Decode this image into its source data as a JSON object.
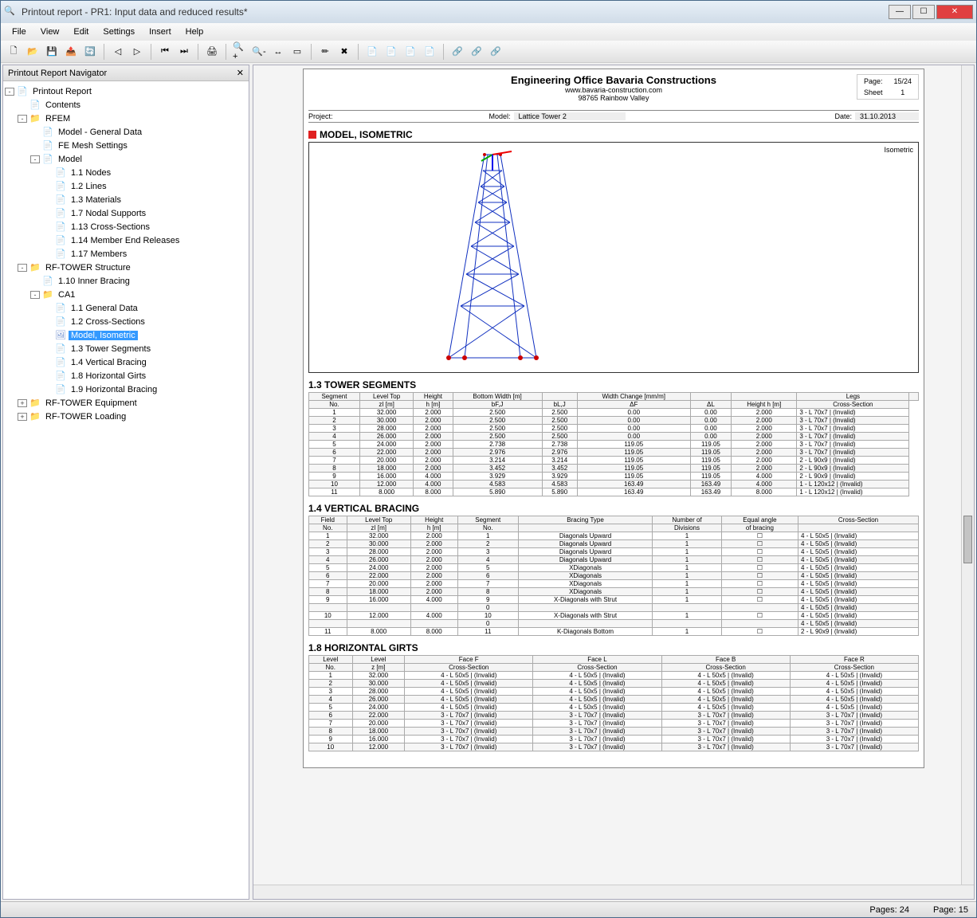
{
  "window": {
    "title": "Printout report - PR1: Input data and reduced results*"
  },
  "menu": [
    "File",
    "View",
    "Edit",
    "Settings",
    "Insert",
    "Help"
  ],
  "navigator": {
    "title": "Printout Report Navigator",
    "tree": [
      {
        "d": 0,
        "exp": "-",
        "ico": "doc",
        "label": "Printout Report"
      },
      {
        "d": 1,
        "exp": "",
        "ico": "doc",
        "label": "Contents"
      },
      {
        "d": 1,
        "exp": "-",
        "ico": "folder",
        "label": "RFEM"
      },
      {
        "d": 2,
        "exp": "",
        "ico": "doc",
        "label": "Model - General Data"
      },
      {
        "d": 2,
        "exp": "",
        "ico": "doc",
        "label": "FE Mesh Settings"
      },
      {
        "d": 2,
        "exp": "-",
        "ico": "doc",
        "label": "Model"
      },
      {
        "d": 3,
        "exp": "",
        "ico": "doc",
        "label": "1.1 Nodes"
      },
      {
        "d": 3,
        "exp": "",
        "ico": "doc",
        "label": "1.2 Lines"
      },
      {
        "d": 3,
        "exp": "",
        "ico": "doc",
        "label": "1.3 Materials"
      },
      {
        "d": 3,
        "exp": "",
        "ico": "doc",
        "label": "1.7 Nodal Supports"
      },
      {
        "d": 3,
        "exp": "",
        "ico": "doc",
        "label": "1.13 Cross-Sections"
      },
      {
        "d": 3,
        "exp": "",
        "ico": "doc",
        "label": "1.14 Member End Releases"
      },
      {
        "d": 3,
        "exp": "",
        "ico": "doc",
        "label": "1.17 Members"
      },
      {
        "d": 1,
        "exp": "-",
        "ico": "folder",
        "label": "RF-TOWER Structure"
      },
      {
        "d": 2,
        "exp": "",
        "ico": "doc",
        "label": "1.10 Inner Bracing"
      },
      {
        "d": 2,
        "exp": "-",
        "ico": "folder",
        "label": "CA1"
      },
      {
        "d": 3,
        "exp": "",
        "ico": "doc",
        "label": "1.1 General Data"
      },
      {
        "d": 3,
        "exp": "",
        "ico": "doc",
        "label": "1.2 Cross-Sections"
      },
      {
        "d": 3,
        "exp": "",
        "ico": "img",
        "label": "Model, Isometric",
        "sel": true
      },
      {
        "d": 3,
        "exp": "",
        "ico": "doc",
        "label": "1.3 Tower Segments"
      },
      {
        "d": 3,
        "exp": "",
        "ico": "doc",
        "label": "1.4 Vertical Bracing"
      },
      {
        "d": 3,
        "exp": "",
        "ico": "doc",
        "label": "1.8 Horizontal Girts"
      },
      {
        "d": 3,
        "exp": "",
        "ico": "doc",
        "label": "1.9 Horizontal Bracing"
      },
      {
        "d": 1,
        "exp": "+",
        "ico": "folder",
        "label": "RF-TOWER Equipment"
      },
      {
        "d": 1,
        "exp": "+",
        "ico": "folder",
        "label": "RF-TOWER Loading"
      }
    ]
  },
  "report": {
    "office": "Engineering Office Bavaria Constructions",
    "website": "www.bavaria-construction.com",
    "address": "98765 Rainbow Valley",
    "page_label": "Page:",
    "page_val": "15/24",
    "sheet_label": "Sheet",
    "sheet_val": "1",
    "project_label": "Project:",
    "project_val": "",
    "model_label": "Model:",
    "model_val": "Lattice Tower 2",
    "date_label": "Date:",
    "date_val": "31.10.2013",
    "sec_iso": "MODEL, ISOMETRIC",
    "iso_label": "Isometric",
    "sec_seg": "1.3 TOWER SEGMENTS",
    "seg_head1": [
      "Segment",
      "Level Top",
      "Height",
      "Bottom Width [m]",
      "",
      "Width Change [mm/m]",
      "",
      "",
      "Legs",
      ""
    ],
    "seg_head2": [
      "No.",
      "zI [m]",
      "h [m]",
      "bF,J",
      "bL,J",
      "ΔF",
      "ΔL",
      "Height h [m]",
      "Cross-Section"
    ],
    "seg_rows": [
      [
        "1",
        "32.000",
        "2.000",
        "2.500",
        "2.500",
        "0.00",
        "0.00",
        "2.000",
        "3 - L 70x7 | (Invalid)"
      ],
      [
        "2",
        "30.000",
        "2.000",
        "2.500",
        "2.500",
        "0.00",
        "0.00",
        "2.000",
        "3 - L 70x7 | (Invalid)"
      ],
      [
        "3",
        "28.000",
        "2.000",
        "2.500",
        "2.500",
        "0.00",
        "0.00",
        "2.000",
        "3 - L 70x7 | (Invalid)"
      ],
      [
        "4",
        "26.000",
        "2.000",
        "2.500",
        "2.500",
        "0.00",
        "0.00",
        "2.000",
        "3 - L 70x7 | (Invalid)"
      ],
      [
        "5",
        "24.000",
        "2.000",
        "2.738",
        "2.738",
        "119.05",
        "119.05",
        "2.000",
        "3 - L 70x7 | (Invalid)"
      ],
      [
        "6",
        "22.000",
        "2.000",
        "2.976",
        "2.976",
        "119.05",
        "119.05",
        "2.000",
        "3 - L 70x7 | (Invalid)"
      ],
      [
        "7",
        "20.000",
        "2.000",
        "3.214",
        "3.214",
        "119.05",
        "119.05",
        "2.000",
        "2 - L 90x9 | (Invalid)"
      ],
      [
        "8",
        "18.000",
        "2.000",
        "3.452",
        "3.452",
        "119.05",
        "119.05",
        "2.000",
        "2 - L 90x9 | (Invalid)"
      ],
      [
        "9",
        "16.000",
        "4.000",
        "3.929",
        "3.929",
        "119.05",
        "119.05",
        "4.000",
        "2 - L 90x9 | (Invalid)"
      ],
      [
        "10",
        "12.000",
        "4.000",
        "4.583",
        "4.583",
        "163.49",
        "163.49",
        "4.000",
        "1 - L 120x12 | (Invalid)"
      ],
      [
        "11",
        "8.000",
        "8.000",
        "5.890",
        "5.890",
        "163.49",
        "163.49",
        "8.000",
        "1 - L 120x12 | (Invalid)"
      ]
    ],
    "sec_vb": "1.4 VERTICAL BRACING",
    "vb_head1": [
      "Field",
      "Level Top",
      "Height",
      "Segment",
      "Bracing Type",
      "Number of",
      "Equal angle",
      "Cross-Section"
    ],
    "vb_head2": [
      "No.",
      "zI [m]",
      "h [m]",
      "No.",
      "",
      "Divisions",
      "of bracing",
      ""
    ],
    "vb_rows": [
      [
        "1",
        "32.000",
        "2.000",
        "1",
        "Diagonals Upward",
        "1",
        "☐",
        "4 - L 50x5 | (Invalid)"
      ],
      [
        "2",
        "30.000",
        "2.000",
        "2",
        "Diagonals Upward",
        "1",
        "☐",
        "4 - L 50x5 | (Invalid)"
      ],
      [
        "3",
        "28.000",
        "2.000",
        "3",
        "Diagonals Upward",
        "1",
        "☐",
        "4 - L 50x5 | (Invalid)"
      ],
      [
        "4",
        "26.000",
        "2.000",
        "4",
        "Diagonals Upward",
        "1",
        "☐",
        "4 - L 50x5 | (Invalid)"
      ],
      [
        "5",
        "24.000",
        "2.000",
        "5",
        "XDiagonals",
        "1",
        "☐",
        "4 - L 50x5 | (Invalid)"
      ],
      [
        "6",
        "22.000",
        "2.000",
        "6",
        "XDiagonals",
        "1",
        "☐",
        "4 - L 50x5 | (Invalid)"
      ],
      [
        "7",
        "20.000",
        "2.000",
        "7",
        "XDiagonals",
        "1",
        "☐",
        "4 - L 50x5 | (Invalid)"
      ],
      [
        "8",
        "18.000",
        "2.000",
        "8",
        "XDiagonals",
        "1",
        "☐",
        "4 - L 50x5 | (Invalid)"
      ],
      [
        "9",
        "16.000",
        "4.000",
        "9",
        "X-Diagonals with Strut",
        "1",
        "☐",
        "4 - L 50x5 | (Invalid)"
      ],
      [
        "",
        "",
        "",
        "0",
        "",
        "",
        "",
        "4 - L 50x5 | (Invalid)"
      ],
      [
        "10",
        "12.000",
        "4.000",
        "10",
        "X-Diagonals with Strut",
        "1",
        "☐",
        "4 - L 50x5 | (Invalid)"
      ],
      [
        "",
        "",
        "",
        "0",
        "",
        "",
        "",
        "4 - L 50x5 | (Invalid)"
      ],
      [
        "11",
        "8.000",
        "8.000",
        "11",
        "K-Diagonals Bottom",
        "1",
        "☐",
        "2 - L 90x9 | (Invalid)"
      ]
    ],
    "sec_hg": "1.8 HORIZONTAL GIRTS",
    "hg_head1": [
      "Level",
      "Level",
      "Face F",
      "Face L",
      "Face B",
      "Face R"
    ],
    "hg_head2": [
      "No.",
      "z [m]",
      "Cross-Section",
      "Cross-Section",
      "Cross-Section",
      "Cross-Section"
    ],
    "hg_rows": [
      [
        "1",
        "32.000",
        "4 - L 50x5 | (Invalid)",
        "4 - L 50x5 | (Invalid)",
        "4 - L 50x5 | (Invalid)",
        "4 - L 50x5 | (Invalid)"
      ],
      [
        "2",
        "30.000",
        "4 - L 50x5 | (Invalid)",
        "4 - L 50x5 | (Invalid)",
        "4 - L 50x5 | (Invalid)",
        "4 - L 50x5 | (Invalid)"
      ],
      [
        "3",
        "28.000",
        "4 - L 50x5 | (Invalid)",
        "4 - L 50x5 | (Invalid)",
        "4 - L 50x5 | (Invalid)",
        "4 - L 50x5 | (Invalid)"
      ],
      [
        "4",
        "26.000",
        "4 - L 50x5 | (Invalid)",
        "4 - L 50x5 | (Invalid)",
        "4 - L 50x5 | (Invalid)",
        "4 - L 50x5 | (Invalid)"
      ],
      [
        "5",
        "24.000",
        "4 - L 50x5 | (Invalid)",
        "4 - L 50x5 | (Invalid)",
        "4 - L 50x5 | (Invalid)",
        "4 - L 50x5 | (Invalid)"
      ],
      [
        "6",
        "22.000",
        "3 - L 70x7 | (Invalid)",
        "3 - L 70x7 | (Invalid)",
        "3 - L 70x7 | (Invalid)",
        "3 - L 70x7 | (Invalid)"
      ],
      [
        "7",
        "20.000",
        "3 - L 70x7 | (Invalid)",
        "3 - L 70x7 | (Invalid)",
        "3 - L 70x7 | (Invalid)",
        "3 - L 70x7 | (Invalid)"
      ],
      [
        "8",
        "18.000",
        "3 - L 70x7 | (Invalid)",
        "3 - L 70x7 | (Invalid)",
        "3 - L 70x7 | (Invalid)",
        "3 - L 70x7 | (Invalid)"
      ],
      [
        "9",
        "16.000",
        "3 - L 70x7 | (Invalid)",
        "3 - L 70x7 | (Invalid)",
        "3 - L 70x7 | (Invalid)",
        "3 - L 70x7 | (Invalid)"
      ],
      [
        "10",
        "12.000",
        "3 - L 70x7 | (Invalid)",
        "3 - L 70x7 | (Invalid)",
        "3 - L 70x7 | (Invalid)",
        "3 - L 70x7 | (Invalid)"
      ]
    ]
  },
  "status": {
    "pages_label": "Pages: 24",
    "page_label": "Page: 15"
  }
}
